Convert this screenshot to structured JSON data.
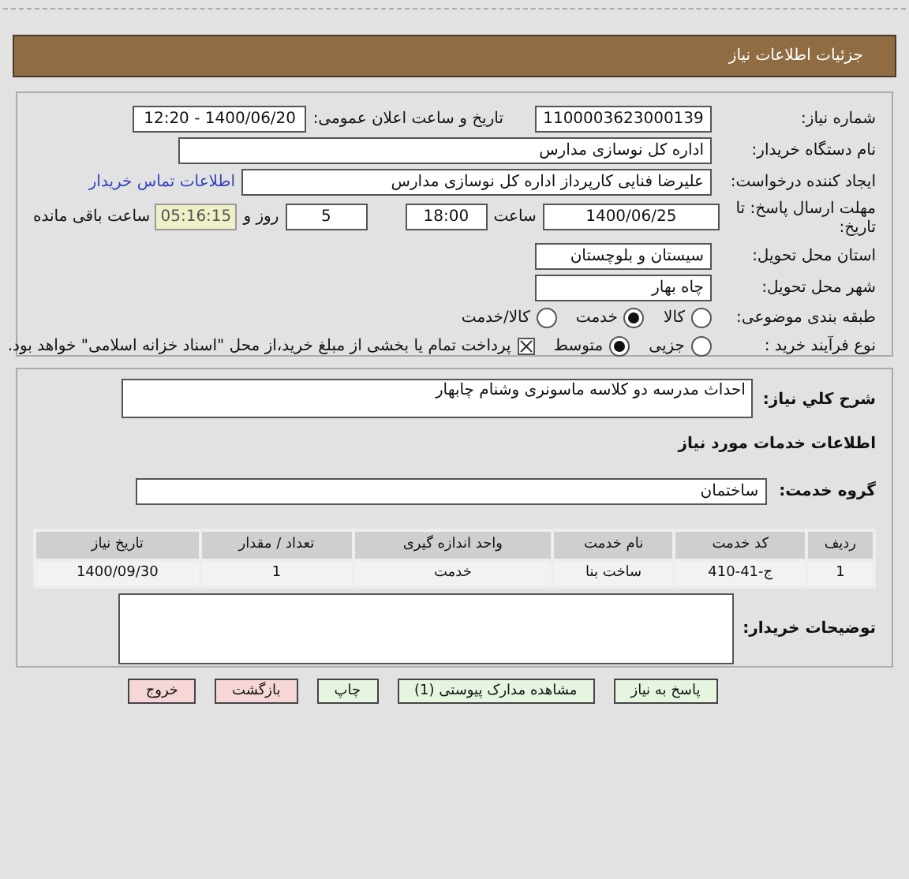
{
  "header": {
    "title": "جزئیات اطلاعات نیاز"
  },
  "need_number": {
    "label": "شماره نیاز:",
    "value": "1100003623000139"
  },
  "announce": {
    "label": "تاریخ و ساعت اعلان عمومی:",
    "value": "1400/06/20 - 12:20"
  },
  "buyer": {
    "label": "نام دستگاه خریدار:",
    "value": "اداره کل نوسازی مدارس"
  },
  "requester": {
    "label": "ایجاد کننده درخواست:",
    "value": "علیرضا فنایی کارپرداز اداره کل نوسازی مدارس",
    "link": "اطلاعات تماس خریدار"
  },
  "deadline": {
    "label": "مهلت ارسال پاسخ: تا تاریخ:",
    "date": "1400/06/25",
    "time_label": "ساعت",
    "time": "18:00",
    "days": "5",
    "days_label": "روز و",
    "remaining": "05:16:15",
    "remaining_label": "ساعت باقی مانده"
  },
  "province": {
    "label": "استان محل تحویل:",
    "value": "سیستان و بلوچستان"
  },
  "city": {
    "label": "شهر محل تحویل:",
    "value": "چاه بهار"
  },
  "category": {
    "label": "طبقه بندی موضوعی:",
    "options": [
      {
        "label": "کالا",
        "selected": false
      },
      {
        "label": "خدمت",
        "selected": true
      },
      {
        "label": "کالا/خدمت",
        "selected": false
      }
    ]
  },
  "process": {
    "label": "نوع فرآیند خرید :",
    "options": [
      {
        "label": "جزیی",
        "selected": false
      },
      {
        "label": "متوسط",
        "selected": true
      }
    ],
    "payment": {
      "checked": true,
      "text": "پرداخت تمام یا بخشی از مبلغ خرید،از محل \"اسناد خزانه اسلامی\" خواهد بود."
    }
  },
  "description": {
    "label": "شرح کلي نياز:",
    "value": "احداث مدرسه دو کلاسه ماسونری وشنام چابهار"
  },
  "services_title": "اطلاعات خدمات مورد نیاز",
  "service_group": {
    "label": "گروه خدمت:",
    "value": "ساختمان"
  },
  "table": {
    "columns": [
      "ردیف",
      "کد خدمت",
      "نام خدمت",
      "واحد اندازه گیری",
      "تعداد / مقدار",
      "تاریخ نیاز"
    ],
    "rows": [
      [
        "1",
        "ج-41-410",
        "ساخت بنا",
        "خدمت",
        "1",
        "1400/09/30"
      ]
    ]
  },
  "buyer_notes": {
    "label": "توضیحات خریدار:"
  },
  "buttons": [
    {
      "label": "پاسخ به نیاز",
      "kind": "green"
    },
    {
      "label": "مشاهده مدارک پیوستی (1)",
      "kind": "green"
    },
    {
      "label": "چاپ",
      "kind": "green"
    },
    {
      "label": "بازگشت",
      "kind": "red"
    },
    {
      "label": "خروج",
      "kind": "red"
    }
  ]
}
